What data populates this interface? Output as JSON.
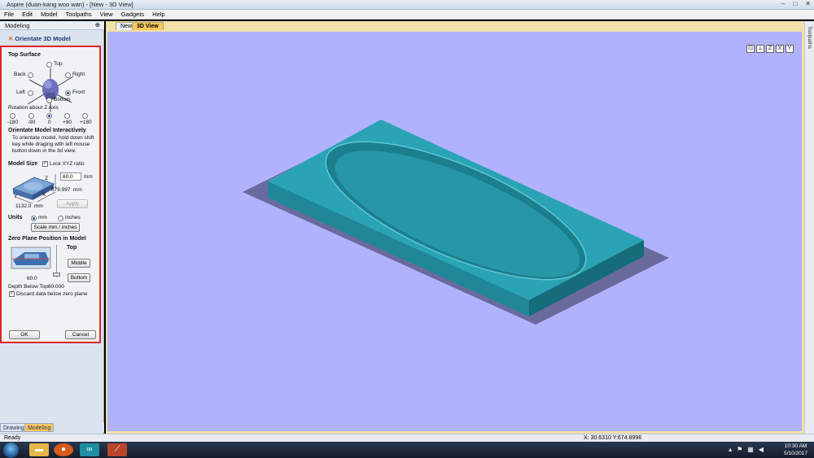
{
  "window": {
    "title": "Aspire (duan-kang woo wan) - [New - 3D View]"
  },
  "menu": [
    "File",
    "Edit",
    "Model",
    "Toolpaths",
    "View",
    "Gadgets",
    "Help"
  ],
  "panel": {
    "title": "Modeling",
    "subtitle": "Orientate 3D Model",
    "top_surface": {
      "heading": "Top Surface",
      "options": {
        "top": "Top",
        "back": "Back",
        "right": "Right",
        "left": "Left",
        "front": "Front",
        "bottom": "Bottom"
      },
      "selected": "Front"
    },
    "rotation": {
      "heading": "Rotation about Z Axis",
      "values": [
        "-180",
        "-90",
        "0",
        "+90",
        "+180"
      ],
      "selected": "0"
    },
    "interactive": {
      "heading": "Orientate Model Interactively",
      "text": [
        "To orientate model, hold down shift",
        "key while draging with left mouse",
        "button down in the  3d view."
      ]
    },
    "model_size": {
      "heading": "Model Size",
      "lock_label": "Lock XYZ ratio",
      "z_value": "60.0",
      "z_unit": "mm",
      "x_value": "579.997",
      "x_unit": "mm",
      "y_value": "1132.0",
      "y_unit": "mm",
      "axis_x": "X",
      "axis_y": "Y",
      "axis_z": "Z",
      "apply_label": "Apply"
    },
    "units": {
      "heading": "Units",
      "mm": "mm",
      "inches": "inches",
      "selected": "mm",
      "scale_label": "Scale mm / inches"
    },
    "zero_plane": {
      "heading": "Zero Plane Position in Model",
      "top_label": "Top",
      "middle_label": "Middle",
      "bottom_label": "Bottom",
      "value": "60.0",
      "depth_label": "Depth Below Top:",
      "depth_value": "60.000",
      "discard_label": "Discard data below zero plane"
    },
    "ok_label": "OK",
    "cancel_label": "Cancel"
  },
  "bottom_tabs": {
    "drawing": "Drawing",
    "modeling": "Modeling"
  },
  "view_tabs": {
    "new": "New",
    "view3d": "3D View"
  },
  "side_tab": "Toolpaths",
  "status": {
    "ready": "Ready",
    "coords": "X: 30.6310 Y:674.8996"
  },
  "taskbar": {
    "time": "10:30 AM",
    "date": "5/10/2017"
  },
  "colors": {
    "model_top": "#2aa3b4",
    "model_shadow": "#6a6a9f",
    "background": "#b1b2fd",
    "highlight_box": "#e0242b"
  }
}
